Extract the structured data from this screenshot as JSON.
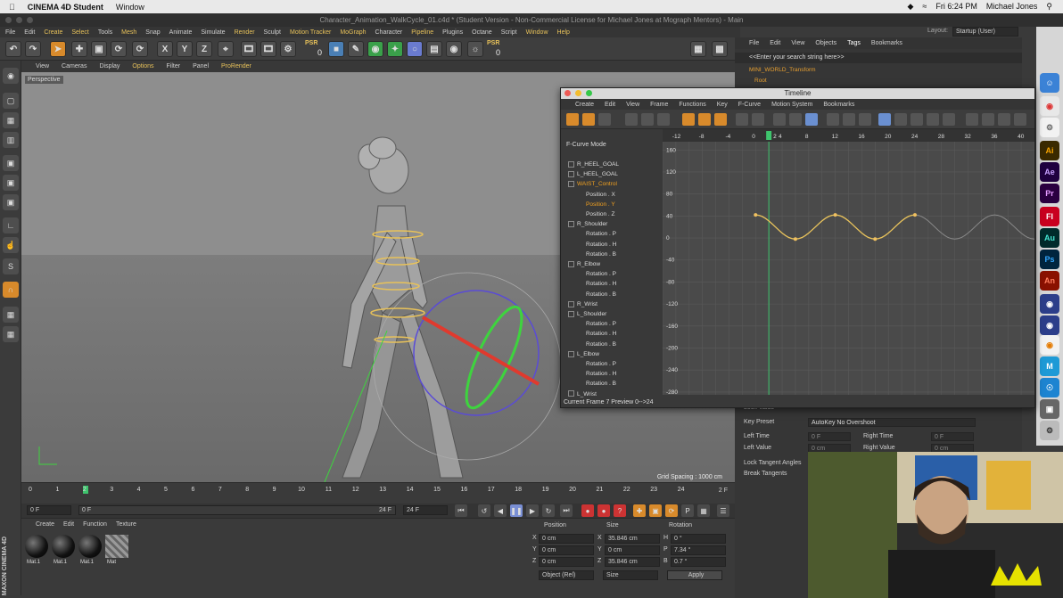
{
  "mac_menu": {
    "apple": "",
    "app_name": "CINEMA 4D Student",
    "window_menu": "Window",
    "clock": "Fri 6:24 PM",
    "user": "Michael Jones"
  },
  "window_title": "Character_Animation_WalkCycle_01.c4d * (Student Version - Non-Commercial License for Michael Jones at Mograph Mentors) - Main",
  "main_menu": [
    "File",
    "Edit",
    "Create",
    "Select",
    "Tools",
    "Mesh",
    "Snap",
    "Animate",
    "Simulate",
    "Render",
    "Sculpt",
    "Motion Tracker",
    "MoGraph",
    "Character",
    "Pipeline",
    "Plugins",
    "Octane",
    "Script",
    "Window",
    "Help"
  ],
  "layout": {
    "label": "Layout:",
    "value": "Startup (User)"
  },
  "toolbar": {
    "psr1": "PSR",
    "psr1_val": "0",
    "psr2": "PSR",
    "psr2_val": "0",
    "x": "X",
    "y": "Y",
    "z": "Z"
  },
  "viewport_menu": [
    "View",
    "Cameras",
    "Display",
    "Options",
    "Filter",
    "Panel",
    "ProRender"
  ],
  "viewport": {
    "label": "Perspective",
    "grid_spacing": "Grid Spacing : 1000 cm"
  },
  "timeline_ticks": [
    "0",
    "1",
    "2",
    "3",
    "4",
    "5",
    "6",
    "7",
    "8",
    "9",
    "10",
    "11",
    "12",
    "13",
    "14",
    "15",
    "16",
    "17",
    "18",
    "19",
    "20",
    "21",
    "22",
    "23",
    "24"
  ],
  "frame_end_label": "2 F",
  "transport": {
    "start": "0 F",
    "range_start": "0 F",
    "range_end": "24 F",
    "end": "24 F"
  },
  "material_menu": [
    "Create",
    "Edit",
    "Function",
    "Texture"
  ],
  "materials": [
    "Mat.1",
    "Mat.1",
    "Mat.1",
    "Mat"
  ],
  "maxon_logo": "MAXON CINEMA 4D",
  "coords": {
    "headers": [
      "Position",
      "Size",
      "Rotation"
    ],
    "rows": [
      {
        "axis": "X",
        "pos": "0 cm",
        "size_axis": "X",
        "size": "35.846 cm",
        "rot_axis": "H",
        "rot": "0 °"
      },
      {
        "axis": "Y",
        "pos": "0 cm",
        "size_axis": "Y",
        "size": "0 cm",
        "rot_axis": "P",
        "rot": "7.34 °"
      },
      {
        "axis": "Z",
        "pos": "0 cm",
        "size_axis": "Z",
        "size": "35.846 cm",
        "rot_axis": "B",
        "rot": "0.7 °"
      }
    ],
    "mode": "Object (Rel)",
    "size_mode": "Size",
    "apply": "Apply"
  },
  "object_manager": {
    "menu": [
      "File",
      "Edit",
      "View",
      "Objects",
      "Tags",
      "Bookmarks"
    ],
    "search": "<<Enter your search string here>>",
    "rows": [
      "MINI_WORLD_Transform",
      "Root"
    ]
  },
  "attributes": {
    "lock_value": "Lock Value",
    "key_preset_label": "Key Preset",
    "key_preset_value": "AutoKey No Overshoot",
    "left_time": "Left Time",
    "left_time_val": "0 F",
    "right_time": "Right Time",
    "right_time_val": "0 F",
    "left_value": "Left Value",
    "left_value_val": "0 cm",
    "right_value": "Right Value",
    "right_value_val": "0 cm",
    "lock_tangent": "Lock Tangent Angles",
    "break_tangents": "Break Tangents"
  },
  "timeline_window": {
    "title": "Timeline",
    "menu": [
      "Create",
      "Edit",
      "View",
      "Frame",
      "Functions",
      "Key",
      "F-Curve",
      "Motion System",
      "Bookmarks"
    ],
    "mode": "F-Curve Mode",
    "tracks": [
      {
        "label": "R_HEEL_GOAL",
        "indent": 0,
        "active": false
      },
      {
        "label": "L_HEEL_GOAL",
        "indent": 0,
        "active": false
      },
      {
        "label": "WAIST_Control",
        "indent": 0,
        "active": true
      },
      {
        "label": "Position . X",
        "indent": 1,
        "active": false
      },
      {
        "label": "Position . Y",
        "indent": 1,
        "active": true
      },
      {
        "label": "Position . Z",
        "indent": 1,
        "active": false
      },
      {
        "label": "R_Shoulder",
        "indent": 0,
        "active": false
      },
      {
        "label": "Rotation . P",
        "indent": 1,
        "active": false
      },
      {
        "label": "Rotation . H",
        "indent": 1,
        "active": false
      },
      {
        "label": "Rotation . B",
        "indent": 1,
        "active": false
      },
      {
        "label": "R_Elbow",
        "indent": 0,
        "active": false
      },
      {
        "label": "Rotation . P",
        "indent": 1,
        "active": false
      },
      {
        "label": "Rotation . H",
        "indent": 1,
        "active": false
      },
      {
        "label": "Rotation . B",
        "indent": 1,
        "active": false
      },
      {
        "label": "R_Wrist",
        "indent": 0,
        "active": false
      },
      {
        "label": "L_Shoulder",
        "indent": 0,
        "active": false
      },
      {
        "label": "Rotation . P",
        "indent": 1,
        "active": false
      },
      {
        "label": "Rotation . H",
        "indent": 1,
        "active": false
      },
      {
        "label": "Rotation . B",
        "indent": 1,
        "active": false
      },
      {
        "label": "L_Elbow",
        "indent": 0,
        "active": false
      },
      {
        "label": "Rotation . P",
        "indent": 1,
        "active": false
      },
      {
        "label": "Rotation . H",
        "indent": 1,
        "active": false
      },
      {
        "label": "Rotation . B",
        "indent": 1,
        "active": false
      },
      {
        "label": "L_Wrist",
        "indent": 0,
        "active": false
      }
    ],
    "status": "Current Frame  7  Preview  0-->24",
    "x_ticks": [
      "-12",
      "-8",
      "-4",
      "0",
      "4",
      "8",
      "12",
      "16",
      "20",
      "24",
      "28",
      "32",
      "36",
      "40"
    ],
    "current_frame_tick": "2",
    "y_ticks": [
      "160",
      "120",
      "80",
      "40",
      "0",
      "-40",
      "-80",
      "-120",
      "-160",
      "-200",
      "-240",
      "-280"
    ],
    "curve_color": "#e8c25a"
  }
}
